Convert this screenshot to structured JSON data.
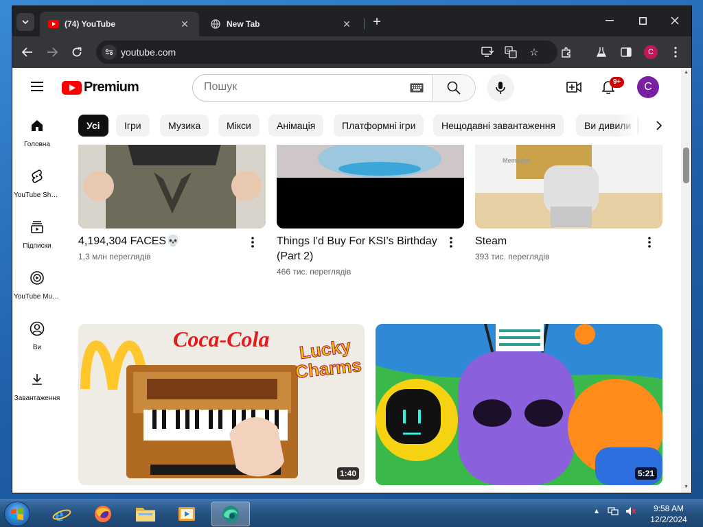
{
  "browser": {
    "tabs": [
      {
        "title": "(74) YouTube",
        "active": true
      },
      {
        "title": "New Tab",
        "active": false
      }
    ],
    "url": "youtube.com",
    "profile_initial": "C"
  },
  "youtube": {
    "logo_text": "Premium",
    "search_placeholder": "Пошук",
    "notifications_badge": "9+",
    "avatar_initial": "C",
    "chips": [
      "Усі",
      "Ігри",
      "Музика",
      "Мікси",
      "Анімація",
      "Платформні ігри",
      "Нещодавні завантаження",
      "Ви дивили"
    ],
    "active_chip": "Усі",
    "sidebar": [
      {
        "label": "Головна",
        "icon": "home-icon"
      },
      {
        "label": "YouTube Shorts",
        "icon": "shorts-icon"
      },
      {
        "label": "Підписки",
        "icon": "subscriptions-icon"
      },
      {
        "label": "YouTube Music",
        "icon": "youtube-music-icon"
      },
      {
        "label": "Ви",
        "icon": "you-icon"
      },
      {
        "label": "Завантаження",
        "icon": "downloads-icon"
      }
    ],
    "videos_row1": [
      {
        "title": "4,194,304 FACES💀",
        "views": "1,3 млн переглядів"
      },
      {
        "title": "Things I'd Buy For KSI's Birthday (Part 2)",
        "views": "466 тис. переглядів"
      },
      {
        "title": "Steam",
        "views": "393 тис. переглядів",
        "watermark": "MemeZee"
      }
    ],
    "videos_row2": [
      {
        "duration": "1:40",
        "thumb_text_1": "Coca-Cola",
        "thumb_text_2": "Lucky",
        "thumb_text_3": "Charms"
      },
      {
        "duration": "5:21"
      }
    ]
  },
  "taskbar": {
    "time": "9:58 AM",
    "date": "12/2/2024"
  }
}
